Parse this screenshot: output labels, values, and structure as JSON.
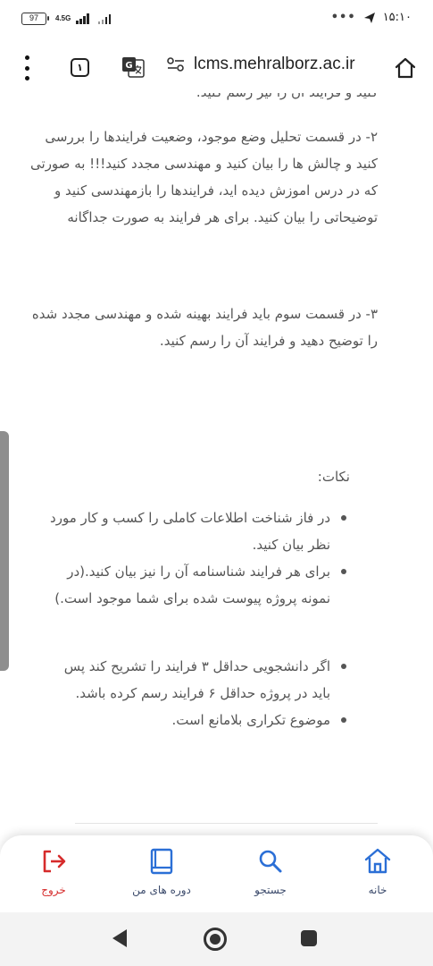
{
  "status_bar": {
    "battery": "97",
    "network": "4.5G",
    "time": "۱۵:۱۰",
    "dots": "•••"
  },
  "toolbar": {
    "tab_count": "۱",
    "url": "lcms.mehralborz.ac.ir"
  },
  "article": {
    "clipped_line": "کنید و فرایند آن را نیز رسم کنید.",
    "paragraph_2": "۲- در قسمت تحلیل وضع موجود، وضعیت فرایندها را بررسی کنید و چالش ها را بیان کنید و مهندسی مجدد کنید!!! به صورتی که در درس اموزش دیده اید، فرایندها را بازمهندسی کنید و توضیحاتی را بیان کنید. برای هر فرایند به صورت جداگانه",
    "paragraph_3": "۳- در قسمت سوم باید فرایند بهینه شده و مهندسی مجدد شده را توضیح دهید و فرایند آن را رسم کنید.",
    "notes_heading": "نکات:",
    "notes": [
      "در فاز شناخت اطلاعات کاملی را کسب و کار مورد نظر بیان کنید.",
      "برای هر فرایند شناسنامه آن را نیز بیان کنید.(در نمونه پروژه پیوست شده برای شما موجود است.)",
      "اگر دانشجویی حداقل ۳ فرایند را تشریح کند پس باید در پروژه حداقل ۶ فرایند رسم کرده باشد.",
      "موضوع تکراری بلامانع است."
    ]
  },
  "bottom_nav": {
    "home": "خانه",
    "search": "جستجو",
    "my_courses": "دوره های من",
    "logout": "خروج"
  },
  "colors": {
    "nav_icon": "#2b6fd6",
    "nav_label": "#3b4a6b",
    "logout": "#d62b2b",
    "text": "#555555"
  }
}
